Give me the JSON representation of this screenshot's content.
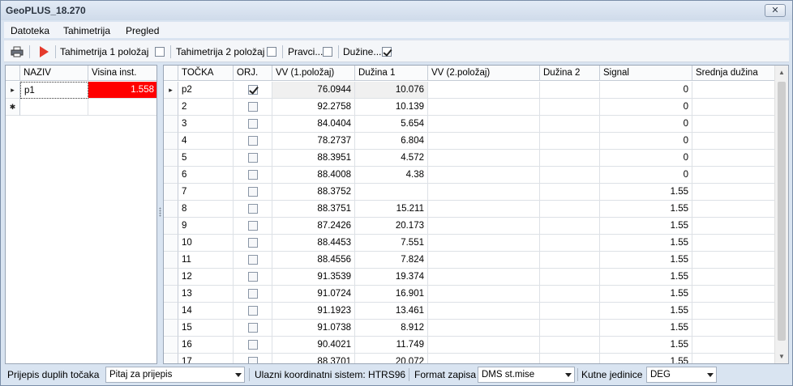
{
  "window": {
    "title": "GeoPLUS_18.270",
    "close_glyph": "✕"
  },
  "menu": [
    "Datoteka",
    "Tahimetrija",
    "Pregled"
  ],
  "toolbar": {
    "print_icon": "printer-icon",
    "run_icon": "play-icon",
    "checks": [
      {
        "label": "Tahimetrija 1 položaj",
        "checked": false
      },
      {
        "label": "Tahimetrija 2 položaj",
        "checked": false
      },
      {
        "label": "Pravci...",
        "checked": false
      },
      {
        "label": "Dužine...",
        "checked": true
      }
    ]
  },
  "station_grid": {
    "columns": [
      "NAZIV",
      "Visina inst."
    ],
    "rows": [
      {
        "marker": "▸",
        "naziv": "p1",
        "visina": "1.558"
      },
      {
        "marker": "✱",
        "naziv": "",
        "visina": ""
      }
    ],
    "highlight_color": "#ff0000"
  },
  "points_grid": {
    "columns": [
      "TOČKA",
      "ORJ.",
      "VV (1.položaj)",
      "Dužina 1",
      "VV (2.položaj)",
      "Dužina 2",
      "Signal",
      "Srednja dužina"
    ],
    "rows": [
      {
        "tocka": "p2",
        "orj": true,
        "vv1": "76.0944",
        "d1": "10.076",
        "vv2": "",
        "d2": "",
        "signal": "0",
        "sred": ""
      },
      {
        "tocka": "2",
        "orj": false,
        "vv1": "92.2758",
        "d1": "10.139",
        "vv2": "",
        "d2": "",
        "signal": "0",
        "sred": ""
      },
      {
        "tocka": "3",
        "orj": false,
        "vv1": "84.0404",
        "d1": "5.654",
        "vv2": "",
        "d2": "",
        "signal": "0",
        "sred": ""
      },
      {
        "tocka": "4",
        "orj": false,
        "vv1": "78.2737",
        "d1": "6.804",
        "vv2": "",
        "d2": "",
        "signal": "0",
        "sred": ""
      },
      {
        "tocka": "5",
        "orj": false,
        "vv1": "88.3951",
        "d1": "4.572",
        "vv2": "",
        "d2": "",
        "signal": "0",
        "sred": ""
      },
      {
        "tocka": "6",
        "orj": false,
        "vv1": "88.4008",
        "d1": "4.38",
        "vv2": "",
        "d2": "",
        "signal": "0",
        "sred": ""
      },
      {
        "tocka": "7",
        "orj": false,
        "vv1": "88.3752",
        "d1": "",
        "vv2": "",
        "d2": "",
        "signal": "1.55",
        "sred": ""
      },
      {
        "tocka": "8",
        "orj": false,
        "vv1": "88.3751",
        "d1": "15.211",
        "vv2": "",
        "d2": "",
        "signal": "1.55",
        "sred": ""
      },
      {
        "tocka": "9",
        "orj": false,
        "vv1": "87.2426",
        "d1": "20.173",
        "vv2": "",
        "d2": "",
        "signal": "1.55",
        "sred": ""
      },
      {
        "tocka": "10",
        "orj": false,
        "vv1": "88.4453",
        "d1": "7.551",
        "vv2": "",
        "d2": "",
        "signal": "1.55",
        "sred": ""
      },
      {
        "tocka": "11",
        "orj": false,
        "vv1": "88.4556",
        "d1": "7.824",
        "vv2": "",
        "d2": "",
        "signal": "1.55",
        "sred": ""
      },
      {
        "tocka": "12",
        "orj": false,
        "vv1": "91.3539",
        "d1": "19.374",
        "vv2": "",
        "d2": "",
        "signal": "1.55",
        "sred": ""
      },
      {
        "tocka": "13",
        "orj": false,
        "vv1": "91.0724",
        "d1": "16.901",
        "vv2": "",
        "d2": "",
        "signal": "1.55",
        "sred": ""
      },
      {
        "tocka": "14",
        "orj": false,
        "vv1": "91.1923",
        "d1": "13.461",
        "vv2": "",
        "d2": "",
        "signal": "1.55",
        "sred": ""
      },
      {
        "tocka": "15",
        "orj": false,
        "vv1": "91.0738",
        "d1": "8.912",
        "vv2": "",
        "d2": "",
        "signal": "1.55",
        "sred": ""
      },
      {
        "tocka": "16",
        "orj": false,
        "vv1": "90.4021",
        "d1": "11.749",
        "vv2": "",
        "d2": "",
        "signal": "1.55",
        "sred": ""
      },
      {
        "tocka": "17",
        "orj": false,
        "vv1": "88.3701",
        "d1": "20.072",
        "vv2": "",
        "d2": "",
        "signal": "1.55",
        "sred": ""
      }
    ],
    "current_marker": "▸"
  },
  "statusbar": {
    "dup_label": "Prijepis duplih točaka",
    "dup_value": "Pitaj za prijepis",
    "coord_label": "Ulazni koordinatni sistem: HTRS96",
    "format_label": "Format zapisa",
    "format_value": "DMS st.mise",
    "angle_label": "Kutne jedinice",
    "angle_value": "DEG"
  }
}
